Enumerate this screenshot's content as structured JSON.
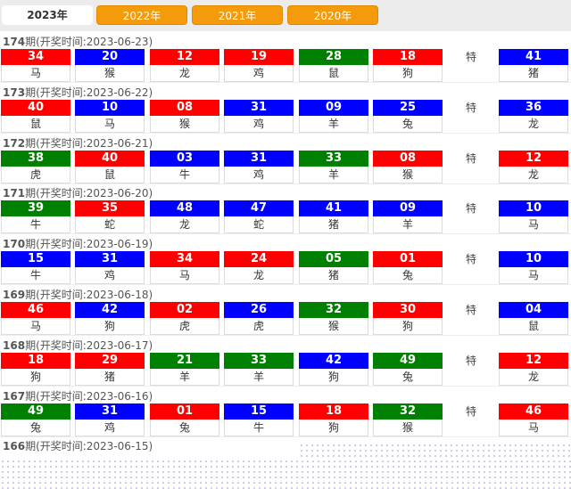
{
  "tabs": [
    {
      "label": "2023年",
      "active": true
    },
    {
      "label": "2022年",
      "active": false
    },
    {
      "label": "2021年",
      "active": false
    },
    {
      "label": "2020年",
      "active": false
    }
  ],
  "special_label": "特",
  "colors": {
    "red": "#ff0000",
    "blue": "#0000ff",
    "green": "#008000",
    "tab_orange": "#f59a0a"
  },
  "records": [
    {
      "period": "174",
      "suffix": "期(开奖时间:2023-06-23)",
      "balls": [
        {
          "n": "34",
          "z": "马",
          "c": "red"
        },
        {
          "n": "20",
          "z": "猴",
          "c": "blue"
        },
        {
          "n": "12",
          "z": "龙",
          "c": "red"
        },
        {
          "n": "19",
          "z": "鸡",
          "c": "red"
        },
        {
          "n": "28",
          "z": "鼠",
          "c": "green"
        },
        {
          "n": "18",
          "z": "狗",
          "c": "red"
        }
      ],
      "special": {
        "n": "41",
        "z": "猪",
        "c": "blue"
      }
    },
    {
      "period": "173",
      "suffix": "期(开奖时间:2023-06-22)",
      "balls": [
        {
          "n": "40",
          "z": "鼠",
          "c": "red"
        },
        {
          "n": "10",
          "z": "马",
          "c": "blue"
        },
        {
          "n": "08",
          "z": "猴",
          "c": "red"
        },
        {
          "n": "31",
          "z": "鸡",
          "c": "blue"
        },
        {
          "n": "09",
          "z": "羊",
          "c": "blue"
        },
        {
          "n": "25",
          "z": "兔",
          "c": "blue"
        }
      ],
      "special": {
        "n": "36",
        "z": "龙",
        "c": "blue"
      }
    },
    {
      "period": "172",
      "suffix": "期(开奖时间:2023-06-21)",
      "balls": [
        {
          "n": "38",
          "z": "虎",
          "c": "green"
        },
        {
          "n": "40",
          "z": "鼠",
          "c": "red"
        },
        {
          "n": "03",
          "z": "牛",
          "c": "blue"
        },
        {
          "n": "31",
          "z": "鸡",
          "c": "blue"
        },
        {
          "n": "33",
          "z": "羊",
          "c": "green"
        },
        {
          "n": "08",
          "z": "猴",
          "c": "red"
        }
      ],
      "special": {
        "n": "12",
        "z": "龙",
        "c": "red"
      }
    },
    {
      "period": "171",
      "suffix": "期(开奖时间:2023-06-20)",
      "balls": [
        {
          "n": "39",
          "z": "牛",
          "c": "green"
        },
        {
          "n": "35",
          "z": "蛇",
          "c": "red"
        },
        {
          "n": "48",
          "z": "龙",
          "c": "blue"
        },
        {
          "n": "47",
          "z": "蛇",
          "c": "blue"
        },
        {
          "n": "41",
          "z": "猪",
          "c": "blue"
        },
        {
          "n": "09",
          "z": "羊",
          "c": "blue"
        }
      ],
      "special": {
        "n": "10",
        "z": "马",
        "c": "blue"
      }
    },
    {
      "period": "170",
      "suffix": "期(开奖时间:2023-06-19)",
      "balls": [
        {
          "n": "15",
          "z": "牛",
          "c": "blue"
        },
        {
          "n": "31",
          "z": "鸡",
          "c": "blue"
        },
        {
          "n": "34",
          "z": "马",
          "c": "red"
        },
        {
          "n": "24",
          "z": "龙",
          "c": "red"
        },
        {
          "n": "05",
          "z": "猪",
          "c": "green"
        },
        {
          "n": "01",
          "z": "兔",
          "c": "red"
        }
      ],
      "special": {
        "n": "10",
        "z": "马",
        "c": "blue"
      }
    },
    {
      "period": "169",
      "suffix": "期(开奖时间:2023-06-18)",
      "balls": [
        {
          "n": "46",
          "z": "马",
          "c": "red"
        },
        {
          "n": "42",
          "z": "狗",
          "c": "blue"
        },
        {
          "n": "02",
          "z": "虎",
          "c": "red"
        },
        {
          "n": "26",
          "z": "虎",
          "c": "blue"
        },
        {
          "n": "32",
          "z": "猴",
          "c": "green"
        },
        {
          "n": "30",
          "z": "狗",
          "c": "red"
        }
      ],
      "special": {
        "n": "04",
        "z": "鼠",
        "c": "blue"
      }
    },
    {
      "period": "168",
      "suffix": "期(开奖时间:2023-06-17)",
      "balls": [
        {
          "n": "18",
          "z": "狗",
          "c": "red"
        },
        {
          "n": "29",
          "z": "猪",
          "c": "red"
        },
        {
          "n": "21",
          "z": "羊",
          "c": "green"
        },
        {
          "n": "33",
          "z": "羊",
          "c": "green"
        },
        {
          "n": "42",
          "z": "狗",
          "c": "blue"
        },
        {
          "n": "49",
          "z": "兔",
          "c": "green"
        }
      ],
      "special": {
        "n": "12",
        "z": "龙",
        "c": "red"
      }
    },
    {
      "period": "167",
      "suffix": "期(开奖时间:2023-06-16)",
      "balls": [
        {
          "n": "49",
          "z": "兔",
          "c": "green"
        },
        {
          "n": "31",
          "z": "鸡",
          "c": "blue"
        },
        {
          "n": "01",
          "z": "兔",
          "c": "red"
        },
        {
          "n": "15",
          "z": "牛",
          "c": "blue"
        },
        {
          "n": "18",
          "z": "狗",
          "c": "red"
        },
        {
          "n": "32",
          "z": "猴",
          "c": "green"
        }
      ],
      "special": {
        "n": "46",
        "z": "马",
        "c": "red"
      }
    },
    {
      "period": "166",
      "suffix": "期(开奖时间:2023-06-15)",
      "balls": [],
      "special": null
    }
  ]
}
